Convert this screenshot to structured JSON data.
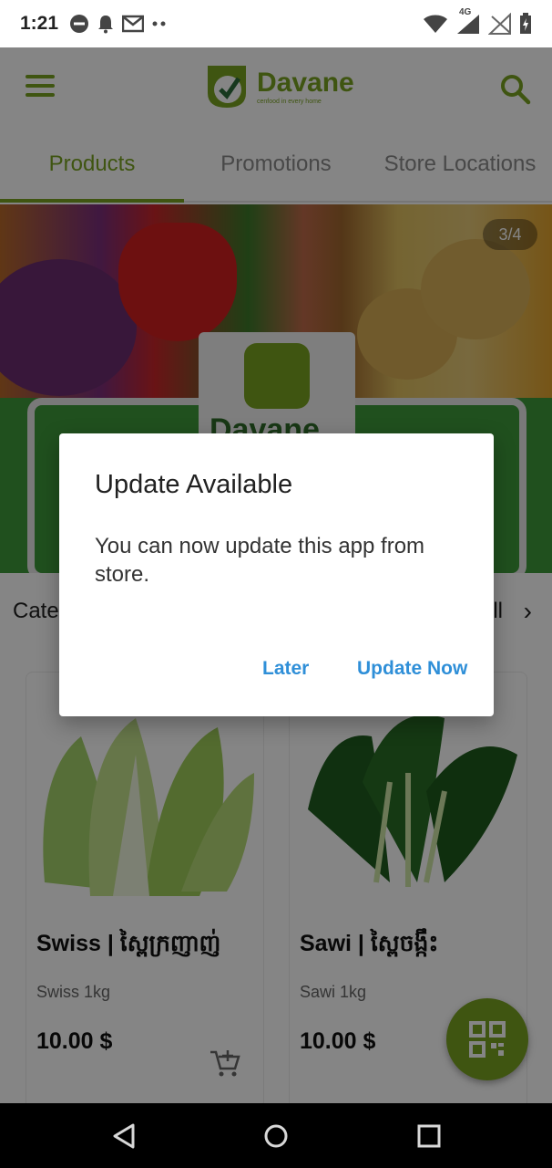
{
  "status_bar": {
    "time": "1:21",
    "network": "4G"
  },
  "app_bar": {
    "logo_text": "Davane",
    "logo_tagline": "cenfood in every home"
  },
  "tabs": [
    {
      "label": "Products",
      "active": true
    },
    {
      "label": "Promotions",
      "active": false
    },
    {
      "label": "Store Locations",
      "active": false
    }
  ],
  "banner": {
    "pager": "3/4",
    "card_text": "Davane"
  },
  "categories": {
    "label": "Cate",
    "view_all": "ll"
  },
  "products": [
    {
      "name": "Swiss | ស្ពៃក្រញាញ់",
      "desc": "Swiss 1kg",
      "price": "10.00 $"
    },
    {
      "name": "Sawi | ស្ពៃចង្កឹះ",
      "desc": "Sawi 1kg",
      "price": "10.00 $"
    }
  ],
  "dialog": {
    "title": "Update Available",
    "message": "You can now update this app from store.",
    "later": "Later",
    "update_now": "Update Now"
  },
  "colors": {
    "brand": "#7aa321",
    "dialog_button": "#2f8fd8",
    "scrim": "rgba(0,0,0,0.48)"
  }
}
